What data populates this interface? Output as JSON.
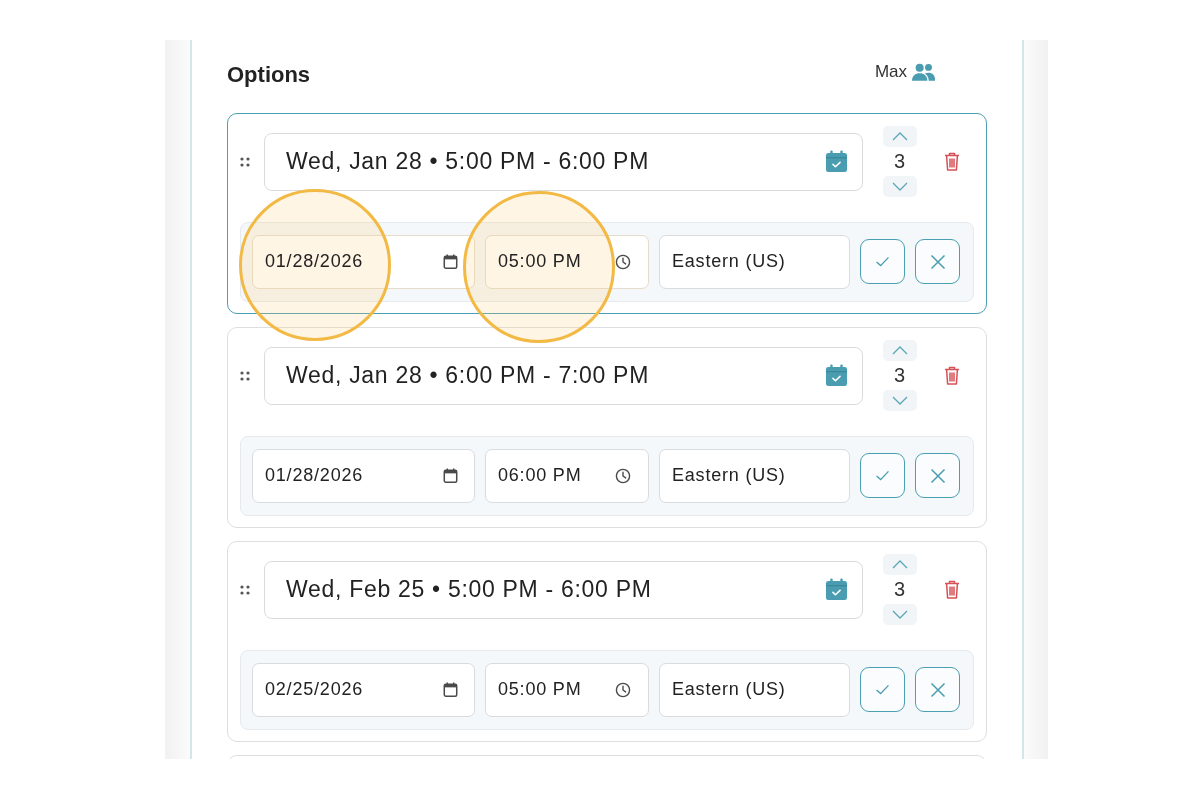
{
  "heading": "Options",
  "capacity": {
    "label": "Max"
  },
  "options": [
    {
      "selected": true,
      "summary": "Wed, Jan 28 • 5:00 PM - 6:00 PM",
      "count": "3",
      "date": {
        "value": "01/28/2026",
        "highlighted": true
      },
      "time": {
        "value": "05:00 PM",
        "highlighted": true
      },
      "timezone": "Eastern (US)"
    },
    {
      "selected": false,
      "summary": "Wed, Jan 28 • 6:00 PM - 7:00 PM",
      "count": "3",
      "date": {
        "value": "01/28/2026",
        "highlighted": false
      },
      "time": {
        "value": "06:00 PM",
        "highlighted": false
      },
      "timezone": "Eastern (US)"
    },
    {
      "selected": false,
      "summary": "Wed, Feb 25 • 5:00 PM - 6:00 PM",
      "count": "3",
      "date": {
        "value": "02/25/2026",
        "highlighted": false
      },
      "time": {
        "value": "05:00 PM",
        "highlighted": false
      },
      "timezone": "Eastern (US)"
    }
  ]
}
